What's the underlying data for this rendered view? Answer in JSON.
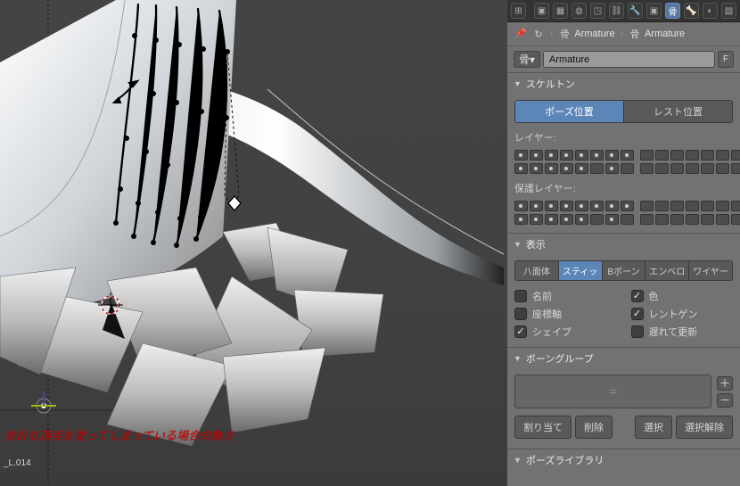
{
  "breadcrumb": {
    "a": "Armature",
    "b": "Armature"
  },
  "name_field": "Armature",
  "f_label": "F",
  "panels": {
    "skeleton": {
      "title": "スケルトン",
      "pose": "ポーズ位置",
      "rest": "レスト位置",
      "layers_label": "レイヤー:",
      "protected_label": "保護レイヤー:"
    },
    "display": {
      "title": "表示",
      "modes": {
        "oct": "八面体",
        "stick": "スティッ",
        "bbone": "Bボーン",
        "env": "エンベロ",
        "wire": "ワイヤー"
      },
      "opts": {
        "name": "名前",
        "color": "色",
        "axes": "座標軸",
        "xray": "レントゲン",
        "shape": "シェイプ",
        "delay": "遅れて更新"
      }
    },
    "bone_group": {
      "title": "ボーングループ",
      "slot_hint": "＝",
      "assign": "割り当て",
      "remove": "削除",
      "select": "選択",
      "deselect": "選択解除"
    },
    "pose_lib": {
      "title": "ポーズライブラリ"
    }
  },
  "viewport": {
    "caption": "余計な頂点を塗ってしまっている場合の動き",
    "bone_label": "_L.014"
  }
}
